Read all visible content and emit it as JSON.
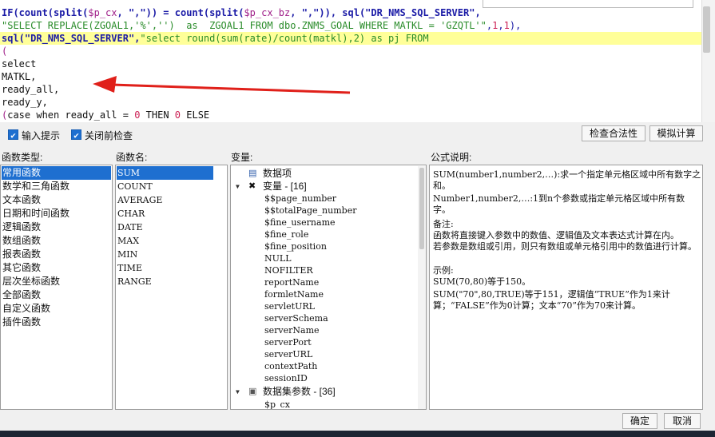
{
  "editor": {
    "lines": [
      [
        [
          "kw",
          "IF(count(split("
        ],
        [
          "var",
          "$p_cx"
        ],
        [
          "kw",
          ", \",\")) = count(split("
        ],
        [
          "var",
          "$p_cx_bz"
        ],
        [
          "kw",
          ", \",\")), sql(\"DR_NMS_SQL_SERVER\","
        ]
      ],
      [
        [
          "str",
          "\"SELECT REPLACE(ZGOAL1,'%','')  as  ZGOAL1 FROM dbo.ZNMS_GOAL WHERE MATKL = 'GZQTL'\""
        ],
        [
          "pun",
          ","
        ],
        [
          "num",
          "1"
        ],
        [
          "pun",
          ","
        ],
        [
          "num",
          "1"
        ],
        [
          "pun",
          "),"
        ]
      ],
      [
        [
          "kw",
          "sql(\"DR_NMS_SQL_SERVER\","
        ],
        [
          "str",
          "\"select round(sum(rate)/count(matkl),2) as pj FROM"
        ]
      ],
      [
        [
          "var",
          "("
        ]
      ],
      [
        [
          "plain",
          "select"
        ]
      ],
      [
        [
          "plain",
          "MATKL,"
        ]
      ],
      [
        [
          "plain",
          "ready_all,"
        ]
      ],
      [
        [
          "plain",
          "ready_y,"
        ]
      ],
      [
        [
          "var",
          "("
        ],
        [
          "plain",
          "case when ready_all = "
        ],
        [
          "num",
          "0"
        ],
        [
          "plain",
          " THEN "
        ],
        [
          "num",
          "0"
        ],
        [
          "plain",
          " ELSE"
        ]
      ]
    ]
  },
  "options": {
    "input_hint": "输入提示",
    "check_before_close": "关闭前检查"
  },
  "buttons": {
    "check_validity": "检查合法性",
    "simulate": "模拟计算",
    "ok": "确定",
    "cancel": "取消"
  },
  "panels": {
    "func_type_label": "函数类型:",
    "func_name_label": "函数名:",
    "variable_label": "变量:",
    "desc_label": "公式说明:"
  },
  "func_types": [
    "常用函数",
    "数学和三角函数",
    "文本函数",
    "日期和时间函数",
    "逻辑函数",
    "数组函数",
    "报表函数",
    "其它函数",
    "层次坐标函数",
    "全部函数",
    "自定义函数",
    "插件函数"
  ],
  "func_type_selected": 0,
  "func_names": [
    "SUM",
    "COUNT",
    "AVERAGE",
    "CHAR",
    "DATE",
    "MAX",
    "MIN",
    "TIME",
    "RANGE"
  ],
  "func_name_selected": 0,
  "variables": {
    "data_item": "数据项",
    "var_cat": "变量 - [16]",
    "var_items": [
      "$$page_number",
      "$$totalPage_number",
      "$fine_username",
      "$fine_role",
      "$fine_position",
      "NULL",
      "NOFILTER",
      "reportName",
      "formletName",
      "servletURL",
      "serverSchema",
      "serverName",
      "serverPort",
      "serverURL",
      "contextPath",
      "sessionID"
    ],
    "dataset_cat": "数据集参数 - [36]",
    "dataset_items": [
      "$p_cx"
    ]
  },
  "description": [
    "SUM(number1,number2,…):求一个指定单元格区域中所有数字之和。",
    "Number1,number2,…:1到n个参数或指定单元格区域中所有数字。",
    "备注:",
    "函数将直接键入参数中的数值、逻辑值及文本表达式计算在内。",
    "若参数是数组或引用，则只有数组或单元格引用中的数值进行计算。",
    "示例:",
    "SUM(70,80)等于150。",
    "SUM(\"70\",80,TRUE)等于151，逻辑值“TRUE”作为1来计算；“FALSE”作为0计算；文本“70”作为70来计算。"
  ],
  "colors": {
    "selection": "#1e6fd0",
    "highlight_line": "#ffff99",
    "arrow": "#e0201a"
  }
}
